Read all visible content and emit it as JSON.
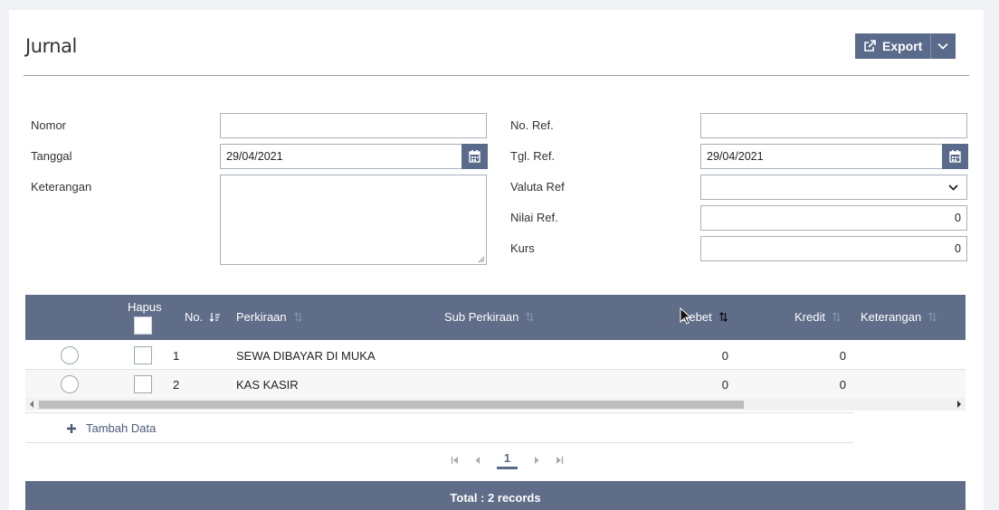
{
  "page": {
    "title": "Jurnal"
  },
  "toolbar": {
    "export_label": "Export"
  },
  "form": {
    "nomor": {
      "label": "Nomor",
      "value": ""
    },
    "tanggal": {
      "label": "Tanggal",
      "value": "29/04/2021"
    },
    "keterangan": {
      "label": "Keterangan",
      "value": ""
    },
    "no_ref": {
      "label": "No. Ref.",
      "value": ""
    },
    "tgl_ref": {
      "label": "Tgl. Ref.",
      "value": "29/04/2021"
    },
    "valuta_ref": {
      "label": "Valuta Ref",
      "value": ""
    },
    "nilai_ref": {
      "label": "Nilai Ref.",
      "value": "0"
    },
    "kurs": {
      "label": "Kurs",
      "value": "0"
    }
  },
  "grid": {
    "columns": {
      "hapus": "Hapus",
      "no": "No.",
      "perkiraan": "Perkiraan",
      "sub_perkiraan": "Sub Perkiraan",
      "debet": "Debet",
      "kredit": "Kredit",
      "keterangan": "Keterangan"
    },
    "rows": [
      {
        "no": "1",
        "perkiraan": "SEWA DIBAYAR DI MUKA",
        "sub_perkiraan": "",
        "debet": "0",
        "kredit": "0",
        "keterangan": ""
      },
      {
        "no": "2",
        "perkiraan": "KAS KASIR",
        "sub_perkiraan": "",
        "debet": "0",
        "kredit": "0",
        "keterangan": ""
      }
    ],
    "add_label": "Tambah Data",
    "pager": {
      "current_page": "1"
    },
    "total_label": "Total : 2 records"
  }
}
